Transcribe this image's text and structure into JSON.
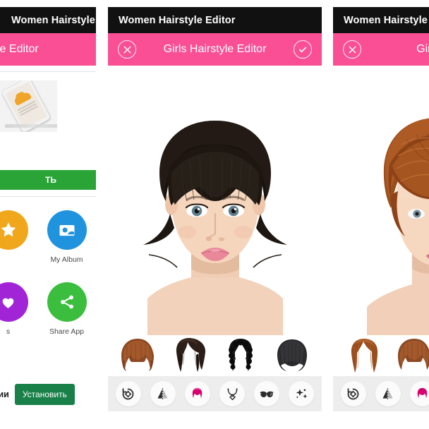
{
  "app": {
    "status_title": "Women Hairstyle Editor",
    "bar_title": "Girls Hairstyle Editor",
    "accent_pink": "#fa4f95",
    "statusbar_black": "#111112"
  },
  "panels": [
    {
      "id": "panel-left",
      "status_title": "Women Hairstyle Editor",
      "bar_title": "yle Editor",
      "clipped": "left"
    },
    {
      "id": "panel-middle",
      "status_title": "Women Hairstyle Editor",
      "bar_title": "Girls Hairstyle Editor",
      "clipped": "none"
    },
    {
      "id": "panel-right",
      "status_title": "Women Hairstyle Editor",
      "bar_title": "Girls Hair",
      "clipped": "right"
    }
  ],
  "appbar_buttons": {
    "close_label": "×",
    "confirm_label": "✓",
    "close_icon": "close-circle-icon",
    "confirm_icon": "check-circle-icon"
  },
  "ad": {
    "info_label": "ⓘ",
    "cta_label": "ТЬ",
    "cta_full": "УСТАНОВИТЬ",
    "cta_color": "#2aa436"
  },
  "home_tiles": [
    {
      "label": "",
      "icon": "star-icon",
      "color": "#f0a71c",
      "clipped": true
    },
    {
      "label": "My Album",
      "icon": "photo-icon",
      "color": "#1f93dd",
      "clipped": false
    },
    {
      "label": "s",
      "icon": "heart-icon",
      "color": "#a124d6",
      "clipped": true
    },
    {
      "label": "Share App",
      "icon": "share-icon",
      "color": "#3bbd3e",
      "clipped": false
    }
  ],
  "bottom_banner": {
    "text": "тиции",
    "button_label": "Установить",
    "button_color": "#1a8049"
  },
  "hair_thumbnails": [
    {
      "name": "auburn-bob-bangs",
      "color": "#8d4a24"
    },
    {
      "name": "dark-wavy-long",
      "color": "#2b1d17"
    },
    {
      "name": "black-curly-long",
      "color": "#121212"
    },
    {
      "name": "dark-straight-bangs",
      "color": "#2a2a2c"
    }
  ],
  "toolbar_items": [
    {
      "name": "rotate-icon",
      "label": "Rotate"
    },
    {
      "name": "flip-mirror-icon",
      "label": "Flip"
    },
    {
      "name": "hairstyle-icon",
      "label": "Hair"
    },
    {
      "name": "necklace-icon",
      "label": "Necklace"
    },
    {
      "name": "sunglasses-icon",
      "label": "Glasses"
    },
    {
      "name": "sparkles-icon",
      "label": "Effects"
    }
  ],
  "models": {
    "middle": {
      "hair_color": "#18120f",
      "style": "dark-updo-with-bangs"
    },
    "right": {
      "hair_color": "#9a4d1d",
      "style": "auburn-bob-side-swept"
    }
  }
}
